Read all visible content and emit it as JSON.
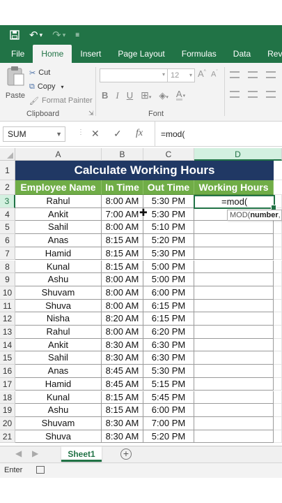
{
  "ribbon_tabs": [
    {
      "label": "File",
      "active": false
    },
    {
      "label": "Home",
      "active": true
    },
    {
      "label": "Insert",
      "active": false
    },
    {
      "label": "Page Layout",
      "active": false
    },
    {
      "label": "Formulas",
      "active": false
    },
    {
      "label": "Data",
      "active": false
    },
    {
      "label": "Review",
      "active": false
    }
  ],
  "clipboard": {
    "paste_label": "Paste",
    "cut_label": "Cut",
    "copy_label": "Copy",
    "format_painter_label": "Format Painter",
    "group_label": "Clipboard"
  },
  "font_group": {
    "font_name": "",
    "font_size": "12",
    "group_label": "Font",
    "bold": "B",
    "italic": "I",
    "underline": "U"
  },
  "formula_bar": {
    "name_box": "SUM",
    "cancel_glyph": "✕",
    "enter_glyph": "✓",
    "fx_glyph": "fx",
    "formula": "=mod("
  },
  "columns": [
    "A",
    "B",
    "C",
    "D"
  ],
  "sheet": {
    "title": "Calculate Working Hours",
    "headers": [
      "Employee Name",
      "In Time",
      "Out Time",
      "Working Hours"
    ],
    "rows": [
      {
        "row": "3",
        "name": "Rahul",
        "in": "8:00 AM",
        "out": "5:30 PM"
      },
      {
        "row": "4",
        "name": "Ankit",
        "in": "7:00 AM",
        "out": "5:30 PM"
      },
      {
        "row": "5",
        "name": "Sahil",
        "in": "8:00 AM",
        "out": "5:10 PM"
      },
      {
        "row": "6",
        "name": "Anas",
        "in": "8:15 AM",
        "out": "5:20 PM"
      },
      {
        "row": "7",
        "name": "Hamid",
        "in": "8:15 AM",
        "out": "5:30 PM"
      },
      {
        "row": "8",
        "name": "Kunal",
        "in": "8:15 AM",
        "out": "5:00 PM"
      },
      {
        "row": "9",
        "name": "Ashu",
        "in": "8:00 AM",
        "out": "5:00 PM"
      },
      {
        "row": "10",
        "name": "Shuvam",
        "in": "8:00 AM",
        "out": "6:00 PM"
      },
      {
        "row": "11",
        "name": "Shuva",
        "in": "8:00 AM",
        "out": "6:15 PM"
      },
      {
        "row": "12",
        "name": "Nisha",
        "in": "8:20 AM",
        "out": "6:15 PM"
      },
      {
        "row": "13",
        "name": "Rahul",
        "in": "8:00 AM",
        "out": "6:20 PM"
      },
      {
        "row": "14",
        "name": "Ankit",
        "in": "8:30 AM",
        "out": "6:30 PM"
      },
      {
        "row": "15",
        "name": "Sahil",
        "in": "8:30 AM",
        "out": "6:30 PM"
      },
      {
        "row": "16",
        "name": "Anas",
        "in": "8:45 AM",
        "out": "5:30 PM"
      },
      {
        "row": "17",
        "name": "Hamid",
        "in": "8:45 AM",
        "out": "5:15 PM"
      },
      {
        "row": "18",
        "name": "Kunal",
        "in": "8:15 AM",
        "out": "5:45 PM"
      },
      {
        "row": "19",
        "name": "Ashu",
        "in": "8:15 AM",
        "out": "6:00 PM"
      },
      {
        "row": "20",
        "name": "Shuvam",
        "in": "8:30 AM",
        "out": "7:00 PM"
      },
      {
        "row": "21",
        "name": "Shuva",
        "in": "8:30 AM",
        "out": "5:20 PM"
      }
    ],
    "active_cell_value": "=mod(",
    "tooltip_prefix": "MOD(",
    "tooltip_arg": "number",
    "tooltip_suffix": ", d"
  },
  "sheet_tabs": {
    "active": "Sheet1",
    "add_glyph": "+"
  },
  "status": {
    "mode": "Enter"
  },
  "colors": {
    "excel_green": "#217346",
    "title_fill": "#203864",
    "header_fill": "#70ad47"
  }
}
